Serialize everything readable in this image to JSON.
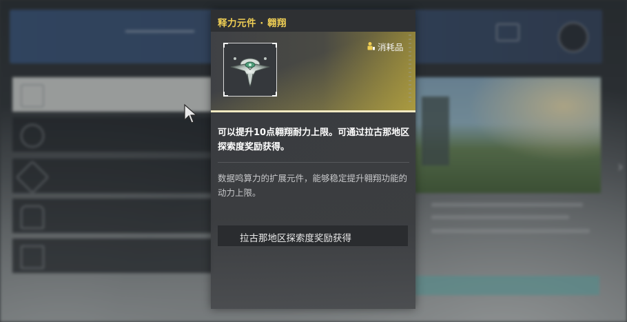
{
  "tooltip": {
    "title": "释力元件 · 翱翔",
    "badge_label": "消耗品",
    "description": "可以提升10点翱翔耐力上限。可通过拉古那地区探索度奖励获得。",
    "flavor_text": "数据鸣算力的扩展元件，能够稳定提升翱翔功能的动力上限。",
    "source_button": "拉古那地区探索度奖励获得"
  },
  "colors": {
    "title": "#f0cf55",
    "panel_bg": "#3c3e42",
    "title_bar": "#2e3033",
    "gold_line": "#f2e9c2"
  },
  "icons": {
    "item": "glider-component-icon",
    "badge": "consumable-icon",
    "cursor": "mouse-pointer-icon"
  }
}
